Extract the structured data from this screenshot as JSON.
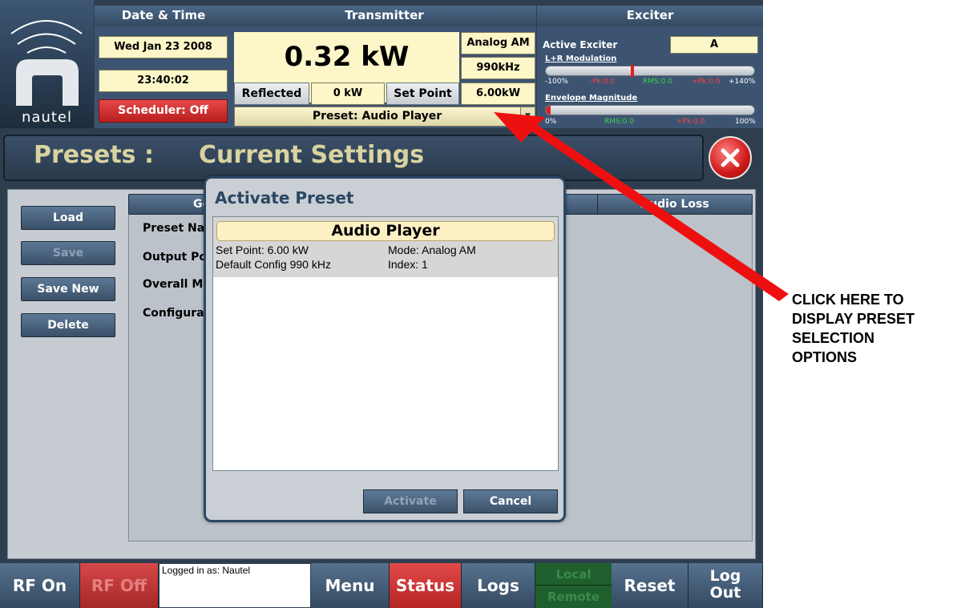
{
  "header": {
    "date_time_label": "Date & Time",
    "transmitter_label": "Transmitter",
    "exciter_label": "Exciter",
    "date": "Wed Jan 23 2008",
    "time": "23:40:02",
    "scheduler": "Scheduler: Off",
    "logo_text": "nautel",
    "power": "0.32 kW",
    "mode": "Analog AM",
    "frequency": "990kHz",
    "reflected_label": "Reflected",
    "reflected_value": "0 kW",
    "set_point_label": "Set Point",
    "set_point_value": "6.00kW",
    "preset_dropdown": "Preset: Audio Player",
    "active_exciter_label": "Active Exciter",
    "active_exciter_value": "A",
    "lr_mod_label": "L+R Modulation",
    "lr_mod_scale": {
      "min": "-100%",
      "neg_pk": "-Pk:0.0",
      "rms": "RMS:0.0",
      "pos_pk": "+Pk:0.0",
      "max": "+140%"
    },
    "env_label": "Envelope Magnitude",
    "env_scale": {
      "min": "0%",
      "rms": "RMS:0.0",
      "pos_pk": "+Pk:0.0",
      "max": "100%"
    }
  },
  "page": {
    "title_prefix": "Presets :",
    "title_main": "Current Settings"
  },
  "side_buttons": {
    "load": "Load",
    "save": "Save",
    "save_new": "Save New",
    "delete": "Delete"
  },
  "tabs": {
    "general": "Ger",
    "audio_loss": "Audio Loss"
  },
  "fields": {
    "preset_name": "Preset Nar",
    "output_power": "Output Po",
    "overall_mod": "Overall Mo",
    "configuration": "Configura"
  },
  "dialog": {
    "title": "Activate Preset",
    "preset_name": "Audio Player",
    "set_point": "Set Point: 6.00 kW",
    "mode": "Mode: Analog AM",
    "config": "Default Config 990 kHz",
    "index": "Index: 1",
    "activate": "Activate",
    "cancel": "Cancel"
  },
  "bottom_bar": {
    "rf_on": "RF On",
    "rf_off": "RF Off",
    "logged_in": "Logged in as: Nautel",
    "menu": "Menu",
    "status": "Status",
    "logs": "Logs",
    "local": "Local",
    "remote": "Remote",
    "reset": "Reset",
    "log_out_1": "Log",
    "log_out_2": "Out"
  },
  "annotation": {
    "line1": "CLICK HERE TO",
    "line2": "DISPLAY PRESET",
    "line3": "SELECTION",
    "line4": "OPTIONS"
  },
  "colors": {
    "accent_red": "#e01010",
    "cream": "#fdf6c8",
    "panel": "#c9ced4"
  }
}
